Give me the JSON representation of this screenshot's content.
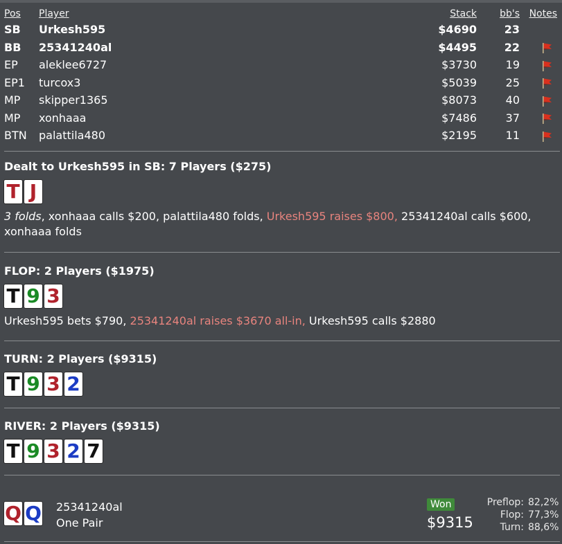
{
  "table": {
    "headers": {
      "pos": "Pos",
      "player": "Player",
      "stack": "Stack",
      "bbs": "bb's",
      "notes": "Notes"
    },
    "rows": [
      {
        "pos": "SB",
        "player": "Urkesh595",
        "stack": "$4690",
        "bbs": "23",
        "bold": true,
        "note_flag": false
      },
      {
        "pos": "BB",
        "player": "25341240al",
        "stack": "$4495",
        "bbs": "22",
        "bold": true,
        "note_flag": true
      },
      {
        "pos": "EP",
        "player": "aleklee6727",
        "stack": "$3730",
        "bbs": "19",
        "bold": false,
        "note_flag": true
      },
      {
        "pos": "EP1",
        "player": "turcox3",
        "stack": "$5039",
        "bbs": "25",
        "bold": false,
        "note_flag": true
      },
      {
        "pos": "MP",
        "player": "skipper1365",
        "stack": "$8073",
        "bbs": "40",
        "bold": false,
        "note_flag": true
      },
      {
        "pos": "MP",
        "player": "xonhaaa",
        "stack": "$7486",
        "bbs": "37",
        "bold": false,
        "note_flag": true
      },
      {
        "pos": "BTN",
        "player": "palattila480",
        "stack": "$2195",
        "bbs": "11",
        "bold": false,
        "note_flag": true
      }
    ]
  },
  "preflop": {
    "title": "Dealt to Urkesh595 in SB: 7 Players ($275)",
    "cards": [
      {
        "rank": "T",
        "suit": "h"
      },
      {
        "rank": "J",
        "suit": "h"
      }
    ],
    "action": {
      "a1": "3 folds",
      "a2": ", xonhaaa calls $200, palattila480 folds, ",
      "a3": "Urkesh595 raises $800,",
      "a4": " 25341240al calls $600, xonhaaa folds"
    }
  },
  "flop": {
    "title": "FLOP: 2 Players ($1975)",
    "cards": [
      {
        "rank": "T",
        "suit": "s"
      },
      {
        "rank": "9",
        "suit": "c"
      },
      {
        "rank": "3",
        "suit": "h"
      }
    ],
    "action": {
      "a1": "Urkesh595 bets $790, ",
      "a2": "25341240al raises $3670 all-in,",
      "a3": " Urkesh595 calls $2880"
    }
  },
  "turn": {
    "title": "TURN: 2 Players ($9315)",
    "cards": [
      {
        "rank": "T",
        "suit": "s"
      },
      {
        "rank": "9",
        "suit": "c"
      },
      {
        "rank": "3",
        "suit": "h"
      },
      {
        "rank": "2",
        "suit": "d"
      }
    ]
  },
  "river": {
    "title": "RIVER: 2 Players ($9315)",
    "cards": [
      {
        "rank": "T",
        "suit": "s"
      },
      {
        "rank": "9",
        "suit": "c"
      },
      {
        "rank": "3",
        "suit": "h"
      },
      {
        "rank": "2",
        "suit": "d"
      },
      {
        "rank": "7",
        "suit": "s"
      }
    ]
  },
  "result": {
    "cards": [
      {
        "rank": "Q",
        "suit": "h"
      },
      {
        "rank": "Q",
        "suit": "d"
      }
    ],
    "player": "25341240al",
    "hand": "One Pair",
    "badge": "Won",
    "amount": "$9315",
    "equity": [
      {
        "label": "Preflop:",
        "value": "82,2%"
      },
      {
        "label": "Flop:",
        "value": "77,3%"
      },
      {
        "label": "Turn:",
        "value": "88,6%"
      }
    ]
  },
  "colors": {
    "background": "#45484c",
    "highlight": "#e8847e",
    "hearts": "#b0222c",
    "spades": "#111111",
    "clubs": "#1a8a25",
    "diamonds": "#1c3cc4",
    "won_badge": "#3f8a3a",
    "flag": "#d9301e"
  },
  "icons": {
    "note_flag": "red-flag-icon"
  }
}
